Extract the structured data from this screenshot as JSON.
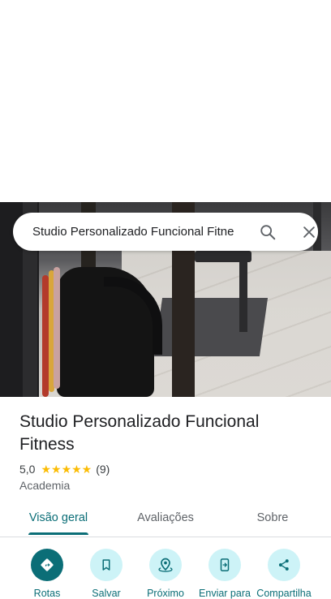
{
  "search": {
    "query": "Studio Personalizado Funcional Fitne"
  },
  "place": {
    "name": "Studio Personalizado Funcional Fitness",
    "rating": "5,0",
    "stars": "★★★★★",
    "review_count": "(9)",
    "category": "Academia"
  },
  "tabs": [
    {
      "label": "Visão geral",
      "active": true
    },
    {
      "label": "Avaliações",
      "active": false
    },
    {
      "label": "Sobre",
      "active": false
    }
  ],
  "actions": [
    {
      "label": "Rotas",
      "icon": "directions-icon"
    },
    {
      "label": "Salvar",
      "icon": "bookmark-icon"
    },
    {
      "label": "Próximo",
      "icon": "nearby-icon"
    },
    {
      "label": "Enviar para",
      "icon": "send-to-phone-icon"
    },
    {
      "label": "Compartilha",
      "icon": "share-icon"
    }
  ],
  "colors": {
    "accent": "#0b6e77",
    "action_bg": "#cdf3f7",
    "star": "#fbbc04"
  }
}
